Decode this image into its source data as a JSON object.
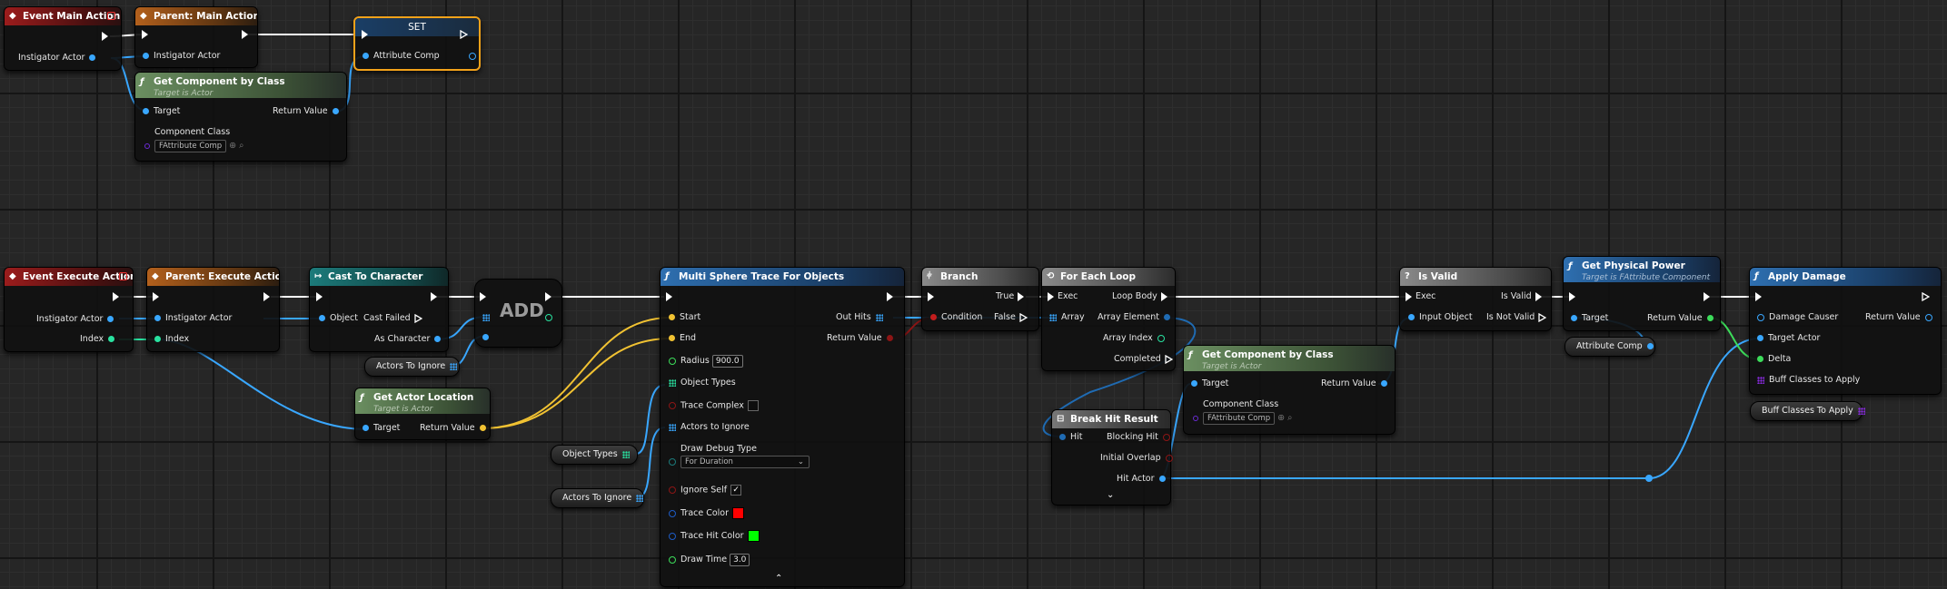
{
  "colors": {
    "exec": "#ffffff",
    "object": "#39a7ff",
    "vector": "#f1c232",
    "float": "#3cdc5a",
    "bool": "#8d1515",
    "int": "#29e2a0",
    "class": "#6b2bd6",
    "selection": "#f3a21a"
  },
  "top": {
    "event_main": {
      "title": "Event Main Action",
      "pin_instigator": "Instigator Actor"
    },
    "parent_main": {
      "title": "Parent: Main Action",
      "pin_instigator": "Instigator Actor"
    },
    "set": {
      "title": "SET",
      "pin_attribute": "Attribute Comp"
    },
    "get_component": {
      "title": "Get Component by Class",
      "subtitle": "Target is Actor",
      "pin_target": "Target",
      "pin_return": "Return Value",
      "pin_class": "Component Class",
      "class_value": "FAttribute Comp"
    }
  },
  "bottom": {
    "event_execute": {
      "title": "Event Execute Action",
      "pin_instigator": "Instigator Actor",
      "pin_index": "Index"
    },
    "parent_execute": {
      "title": "Parent: Execute Action",
      "pin_instigator": "Instigator Actor",
      "pin_index": "Index"
    },
    "cast": {
      "title": "Cast To Character",
      "pin_object": "Object",
      "pin_failed": "Cast Failed",
      "pin_as": "As Character"
    },
    "actors_ignore_1": {
      "label": "Actors To Ignore"
    },
    "add": {
      "label": "ADD"
    },
    "get_actor_location": {
      "title": "Get Actor Location",
      "subtitle": "Target is Actor",
      "pin_target": "Target",
      "pin_return": "Return Value"
    },
    "object_types_var": {
      "label": "Object Types"
    },
    "actors_ignore_2": {
      "label": "Actors To Ignore"
    },
    "sphere_trace": {
      "title": "Multi Sphere Trace For Objects",
      "pin_start": "Start",
      "pin_end": "End",
      "pin_out_hits": "Out Hits",
      "pin_return": "Return Value",
      "pin_radius": "Radius",
      "radius_value": "900.0",
      "pin_object_types": "Object Types",
      "pin_trace_complex": "Trace Complex",
      "pin_actors_ignore": "Actors to Ignore",
      "pin_draw_debug": "Draw Debug Type",
      "draw_debug_value": "For Duration",
      "pin_ignore_self": "Ignore Self",
      "pin_trace_color": "Trace Color",
      "pin_trace_hit_color": "Trace Hit Color",
      "pin_draw_time": "Draw Time",
      "draw_time_value": "3.0",
      "trace_color": "#ff0000",
      "trace_hit_color": "#00ff00"
    },
    "branch": {
      "title": "Branch",
      "pin_condition": "Condition",
      "pin_true": "True",
      "pin_false": "False"
    },
    "for_each": {
      "title": "For Each Loop",
      "pin_exec": "Exec",
      "pin_loop_body": "Loop Body",
      "pin_array": "Array",
      "pin_array_element": "Array Element",
      "pin_array_index": "Array Index",
      "pin_completed": "Completed"
    },
    "break_hit": {
      "title": "Break Hit Result",
      "pin_hit": "Hit",
      "pin_blocking": "Blocking Hit",
      "pin_initial": "Initial Overlap",
      "pin_hit_actor": "Hit Actor"
    },
    "get_component_2": {
      "title": "Get Component by Class",
      "subtitle": "Target is Actor",
      "pin_target": "Target",
      "pin_return": "Return Value",
      "pin_class": "Component Class",
      "class_value": "FAttribute Comp"
    },
    "is_valid": {
      "title": "Is Valid",
      "pin_exec": "Exec",
      "pin_input": "Input Object",
      "pin_valid": "Is Valid",
      "pin_not_valid": "Is Not Valid"
    },
    "get_physical_power": {
      "title": "Get Physical Power",
      "subtitle": "Target is FAttribute Component",
      "pin_target": "Target",
      "pin_return": "Return Value"
    },
    "attribute_comp_var": {
      "label": "Attribute Comp"
    },
    "apply_damage": {
      "title": "Apply Damage",
      "pin_causer": "Damage Causer",
      "pin_return": "Return Value",
      "pin_target_actor": "Target Actor",
      "pin_delta": "Delta",
      "pin_buff": "Buff Classes to Apply"
    },
    "buff_var": {
      "label": "Buff Classes To Apply"
    }
  }
}
